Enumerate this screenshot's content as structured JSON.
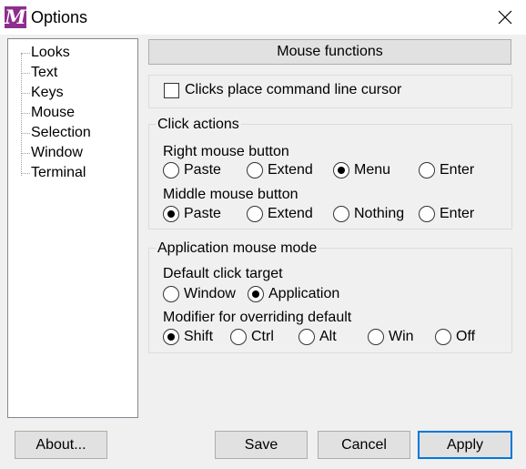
{
  "window": {
    "title": "Options",
    "icon": "M"
  },
  "tree": {
    "items": [
      "Looks",
      "Text",
      "Keys",
      "Mouse",
      "Selection",
      "Window",
      "Terminal"
    ]
  },
  "section_title": "Mouse functions",
  "clicks_place_cursor": {
    "label": "Clicks place command line cursor",
    "checked": false
  },
  "click_actions": {
    "title": "Click actions",
    "right": {
      "label": "Right mouse button",
      "options": [
        "Paste",
        "Extend",
        "Menu",
        "Enter"
      ],
      "selected": "Menu"
    },
    "middle": {
      "label": "Middle mouse button",
      "options": [
        "Paste",
        "Extend",
        "Nothing",
        "Enter"
      ],
      "selected": "Paste"
    }
  },
  "app_mouse_mode": {
    "title": "Application mouse mode",
    "default_target": {
      "label": "Default click target",
      "options": [
        "Window",
        "Application"
      ],
      "selected": "Application"
    },
    "modifier": {
      "label": "Modifier for overriding default",
      "options": [
        "Shift",
        "Ctrl",
        "Alt",
        "Win",
        "Off"
      ],
      "selected": "Shift"
    }
  },
  "buttons": {
    "about": "About...",
    "save": "Save",
    "cancel": "Cancel",
    "apply": "Apply"
  }
}
